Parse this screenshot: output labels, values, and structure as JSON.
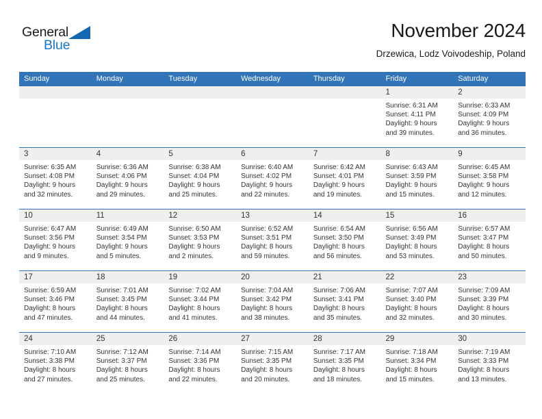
{
  "logo": {
    "word1": "General",
    "word2": "Blue",
    "triangle_color": "#1268b3",
    "word2_color": "#1878c8"
  },
  "header": {
    "title": "November 2024",
    "subtitle": "Drzewica, Lodz Voivodeship, Poland"
  },
  "theme": {
    "header_blue": "#3174b8",
    "day_band_gray": "#efefef",
    "text": "#333333"
  },
  "weekdays": [
    "Sunday",
    "Monday",
    "Tuesday",
    "Wednesday",
    "Thursday",
    "Friday",
    "Saturday"
  ],
  "weeks": [
    [
      {
        "day": "",
        "lines": []
      },
      {
        "day": "",
        "lines": []
      },
      {
        "day": "",
        "lines": []
      },
      {
        "day": "",
        "lines": []
      },
      {
        "day": "",
        "lines": []
      },
      {
        "day": "1",
        "lines": [
          "Sunrise: 6:31 AM",
          "Sunset: 4:11 PM",
          "Daylight: 9 hours",
          "and 39 minutes."
        ]
      },
      {
        "day": "2",
        "lines": [
          "Sunrise: 6:33 AM",
          "Sunset: 4:09 PM",
          "Daylight: 9 hours",
          "and 36 minutes."
        ]
      }
    ],
    [
      {
        "day": "3",
        "lines": [
          "Sunrise: 6:35 AM",
          "Sunset: 4:08 PM",
          "Daylight: 9 hours",
          "and 32 minutes."
        ]
      },
      {
        "day": "4",
        "lines": [
          "Sunrise: 6:36 AM",
          "Sunset: 4:06 PM",
          "Daylight: 9 hours",
          "and 29 minutes."
        ]
      },
      {
        "day": "5",
        "lines": [
          "Sunrise: 6:38 AM",
          "Sunset: 4:04 PM",
          "Daylight: 9 hours",
          "and 25 minutes."
        ]
      },
      {
        "day": "6",
        "lines": [
          "Sunrise: 6:40 AM",
          "Sunset: 4:02 PM",
          "Daylight: 9 hours",
          "and 22 minutes."
        ]
      },
      {
        "day": "7",
        "lines": [
          "Sunrise: 6:42 AM",
          "Sunset: 4:01 PM",
          "Daylight: 9 hours",
          "and 19 minutes."
        ]
      },
      {
        "day": "8",
        "lines": [
          "Sunrise: 6:43 AM",
          "Sunset: 3:59 PM",
          "Daylight: 9 hours",
          "and 15 minutes."
        ]
      },
      {
        "day": "9",
        "lines": [
          "Sunrise: 6:45 AM",
          "Sunset: 3:58 PM",
          "Daylight: 9 hours",
          "and 12 minutes."
        ]
      }
    ],
    [
      {
        "day": "10",
        "lines": [
          "Sunrise: 6:47 AM",
          "Sunset: 3:56 PM",
          "Daylight: 9 hours",
          "and 9 minutes."
        ]
      },
      {
        "day": "11",
        "lines": [
          "Sunrise: 6:49 AM",
          "Sunset: 3:54 PM",
          "Daylight: 9 hours",
          "and 5 minutes."
        ]
      },
      {
        "day": "12",
        "lines": [
          "Sunrise: 6:50 AM",
          "Sunset: 3:53 PM",
          "Daylight: 9 hours",
          "and 2 minutes."
        ]
      },
      {
        "day": "13",
        "lines": [
          "Sunrise: 6:52 AM",
          "Sunset: 3:51 PM",
          "Daylight: 8 hours",
          "and 59 minutes."
        ]
      },
      {
        "day": "14",
        "lines": [
          "Sunrise: 6:54 AM",
          "Sunset: 3:50 PM",
          "Daylight: 8 hours",
          "and 56 minutes."
        ]
      },
      {
        "day": "15",
        "lines": [
          "Sunrise: 6:56 AM",
          "Sunset: 3:49 PM",
          "Daylight: 8 hours",
          "and 53 minutes."
        ]
      },
      {
        "day": "16",
        "lines": [
          "Sunrise: 6:57 AM",
          "Sunset: 3:47 PM",
          "Daylight: 8 hours",
          "and 50 minutes."
        ]
      }
    ],
    [
      {
        "day": "17",
        "lines": [
          "Sunrise: 6:59 AM",
          "Sunset: 3:46 PM",
          "Daylight: 8 hours",
          "and 47 minutes."
        ]
      },
      {
        "day": "18",
        "lines": [
          "Sunrise: 7:01 AM",
          "Sunset: 3:45 PM",
          "Daylight: 8 hours",
          "and 44 minutes."
        ]
      },
      {
        "day": "19",
        "lines": [
          "Sunrise: 7:02 AM",
          "Sunset: 3:44 PM",
          "Daylight: 8 hours",
          "and 41 minutes."
        ]
      },
      {
        "day": "20",
        "lines": [
          "Sunrise: 7:04 AM",
          "Sunset: 3:42 PM",
          "Daylight: 8 hours",
          "and 38 minutes."
        ]
      },
      {
        "day": "21",
        "lines": [
          "Sunrise: 7:06 AM",
          "Sunset: 3:41 PM",
          "Daylight: 8 hours",
          "and 35 minutes."
        ]
      },
      {
        "day": "22",
        "lines": [
          "Sunrise: 7:07 AM",
          "Sunset: 3:40 PM",
          "Daylight: 8 hours",
          "and 32 minutes."
        ]
      },
      {
        "day": "23",
        "lines": [
          "Sunrise: 7:09 AM",
          "Sunset: 3:39 PM",
          "Daylight: 8 hours",
          "and 30 minutes."
        ]
      }
    ],
    [
      {
        "day": "24",
        "lines": [
          "Sunrise: 7:10 AM",
          "Sunset: 3:38 PM",
          "Daylight: 8 hours",
          "and 27 minutes."
        ]
      },
      {
        "day": "25",
        "lines": [
          "Sunrise: 7:12 AM",
          "Sunset: 3:37 PM",
          "Daylight: 8 hours",
          "and 25 minutes."
        ]
      },
      {
        "day": "26",
        "lines": [
          "Sunrise: 7:14 AM",
          "Sunset: 3:36 PM",
          "Daylight: 8 hours",
          "and 22 minutes."
        ]
      },
      {
        "day": "27",
        "lines": [
          "Sunrise: 7:15 AM",
          "Sunset: 3:35 PM",
          "Daylight: 8 hours",
          "and 20 minutes."
        ]
      },
      {
        "day": "28",
        "lines": [
          "Sunrise: 7:17 AM",
          "Sunset: 3:35 PM",
          "Daylight: 8 hours",
          "and 18 minutes."
        ]
      },
      {
        "day": "29",
        "lines": [
          "Sunrise: 7:18 AM",
          "Sunset: 3:34 PM",
          "Daylight: 8 hours",
          "and 15 minutes."
        ]
      },
      {
        "day": "30",
        "lines": [
          "Sunrise: 7:19 AM",
          "Sunset: 3:33 PM",
          "Daylight: 8 hours",
          "and 13 minutes."
        ]
      }
    ]
  ]
}
